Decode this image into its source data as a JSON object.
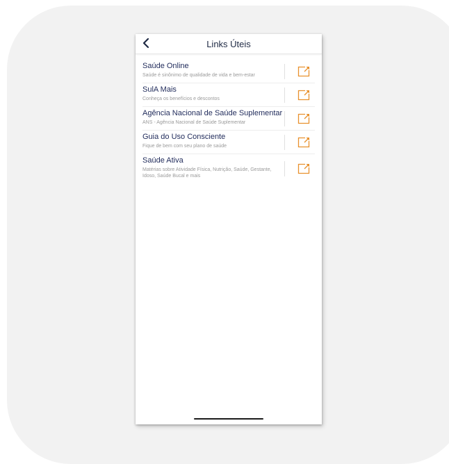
{
  "header": {
    "title": "Links Úteis"
  },
  "links": [
    {
      "title": "Saúde Online",
      "description": "Saúde é sinônimo de qualidade de vida e bem-estar"
    },
    {
      "title": "SulA Mais",
      "description": "Conheça os benefícios e descontos"
    },
    {
      "title": "Agência Nacional de Saúde Suplementar",
      "description": "ANS - Agência Nacional de Saúde Suplementar"
    },
    {
      "title": "Guia do Uso Consciente",
      "description": "Fique de bem com seu plano de saúde"
    },
    {
      "title": "Saúde Ativa",
      "description": "Matérias sobre Atividade Física, Nutrição, Saúde, Gestante, Idoso, Saúde Bucal e mais"
    }
  ],
  "icons": {
    "back": "chevron-left-icon",
    "external": "external-link-icon"
  },
  "colors": {
    "accent": "#e8912d",
    "title_text": "#1f2a5a",
    "description_text": "#9a9a9a",
    "background": "#f2f2f2"
  }
}
